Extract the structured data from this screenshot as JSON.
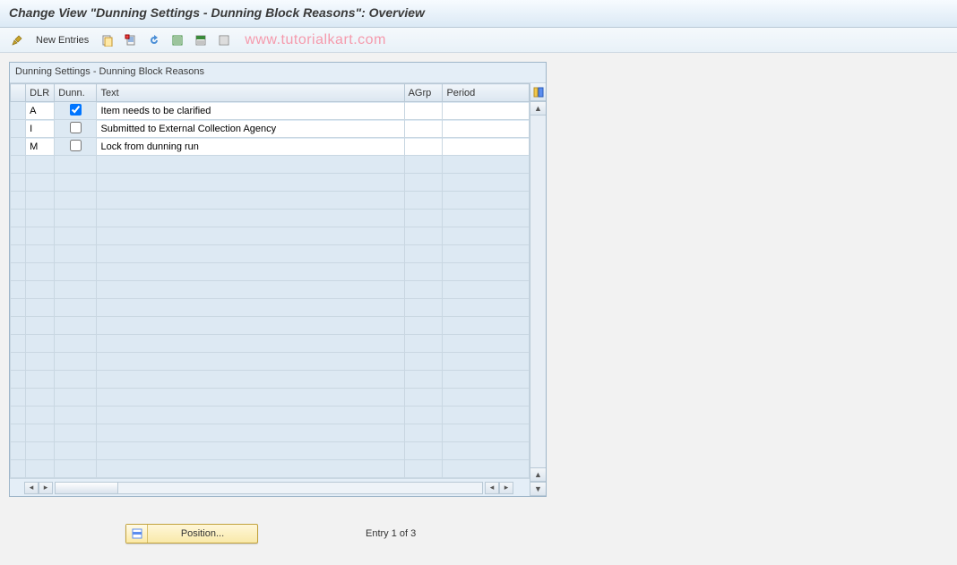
{
  "header": {
    "title": "Change View \"Dunning Settings - Dunning Block Reasons\": Overview"
  },
  "toolbar": {
    "new_entries_label": "New Entries"
  },
  "watermark": "www.tutorialkart.com",
  "panel": {
    "title": "Dunning Settings - Dunning Block Reasons",
    "columns": {
      "dlr": "DLR",
      "dunn": "Dunn.",
      "text": "Text",
      "agrp": "AGrp",
      "period": "Period"
    },
    "rows": [
      {
        "dlr": "A",
        "dunn": true,
        "text": "Item needs to be clarified",
        "agrp": "",
        "period": ""
      },
      {
        "dlr": "I",
        "dunn": false,
        "text": "Submitted to External Collection Agency",
        "agrp": "",
        "period": ""
      },
      {
        "dlr": "M",
        "dunn": false,
        "text": "Lock from dunning run",
        "agrp": "",
        "period": ""
      }
    ],
    "empty_rows": 18
  },
  "footer": {
    "position_label": "Position...",
    "entry_text": "Entry 1 of 3"
  }
}
